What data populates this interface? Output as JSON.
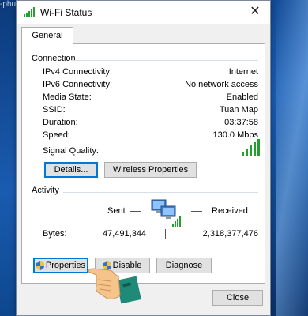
{
  "desktop": {
    "text": "-phu"
  },
  "window": {
    "title": "Wi-Fi Status",
    "close_glyph": "✕",
    "tab_label": "General",
    "connection": {
      "heading": "Connection",
      "rows": [
        {
          "label": "IPv4 Connectivity:",
          "value": "Internet"
        },
        {
          "label": "IPv6 Connectivity:",
          "value": "No network access"
        },
        {
          "label": "Media State:",
          "value": "Enabled"
        },
        {
          "label": "SSID:",
          "value": "Tuan Map"
        },
        {
          "label": "Duration:",
          "value": "03:37:58"
        },
        {
          "label": "Speed:",
          "value": "130.0 Mbps"
        }
      ],
      "signal_label": "Signal Quality:",
      "signal_bars": 5,
      "details_button": "Details...",
      "wireless_button": "Wireless Properties"
    },
    "activity": {
      "heading": "Activity",
      "sent_label": "Sent",
      "received_label": "Received",
      "bytes_label": "Bytes:",
      "bytes_sent": "47,491,344",
      "bytes_received": "2,318,377,476",
      "properties_button": "Properties",
      "disable_button": "Disable",
      "diagnose_button": "Diagnose"
    },
    "close_button": "Close"
  },
  "colors": {
    "signal": "#1fa12b",
    "focus": "#0078d7",
    "accent_title": "#ffffff"
  }
}
